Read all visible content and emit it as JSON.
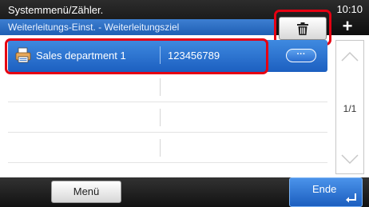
{
  "header": {
    "title": "Systemmenü/Zähler.",
    "subtitle": "Weiterleitungs-Einst. - Weiterleitungsziel",
    "time": "10:10",
    "add_label": "+"
  },
  "list": {
    "rows": [
      {
        "name": "Sales department 1",
        "number": "123456789",
        "selected": true,
        "detail_label": "···"
      }
    ],
    "empty_rows": 4
  },
  "scroll": {
    "page": "1/1"
  },
  "footer": {
    "menu_label": "Menü",
    "end_label": "Ende"
  },
  "colors": {
    "accent": "#1f5fb4",
    "highlight": "#e60012"
  },
  "icons": {
    "trash": "trash-icon",
    "printer": "printer-icon",
    "enter": "enter-icon"
  }
}
